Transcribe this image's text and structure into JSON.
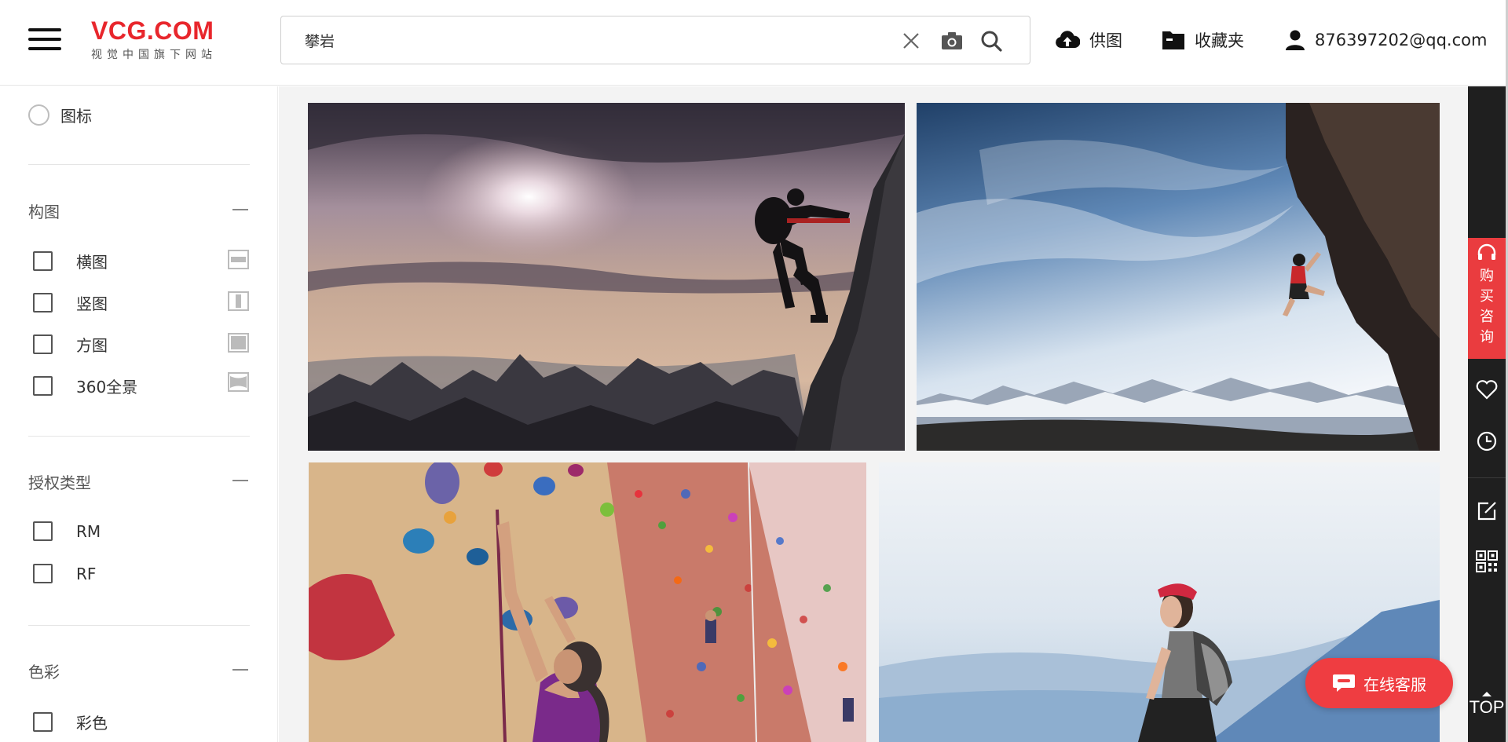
{
  "logo": {
    "main": "VCG.COM",
    "sub": "视觉中国旗下网站"
  },
  "search": {
    "value": "攀岩"
  },
  "header": {
    "supply": "供图",
    "favorites": "收藏夹",
    "user": "876397202@qq.com"
  },
  "sidebar": {
    "icon_filter": "图标",
    "composition": {
      "title": "构图",
      "items": [
        "横图",
        "竖图",
        "方图",
        "360全景"
      ]
    },
    "license": {
      "title": "授权类型",
      "items": [
        "RM",
        "RF"
      ]
    },
    "color": {
      "title": "色彩",
      "items": [
        "彩色"
      ]
    }
  },
  "toolbar": {
    "consult": "购买咨询",
    "top": "TOP"
  },
  "service_button": "在线客服",
  "colors": {
    "brand": "#e8262c",
    "accent_red": "#ea3c3f",
    "toolbar_bg": "#1f1f1f"
  }
}
